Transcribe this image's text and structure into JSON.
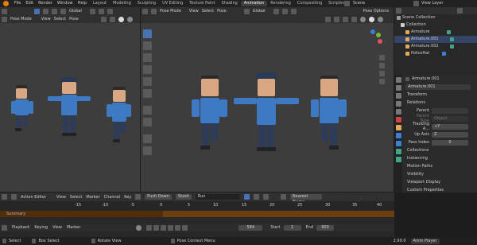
{
  "topbar": {
    "menus": [
      "File",
      "Edit",
      "Render",
      "Window",
      "Help"
    ],
    "workspaces": [
      "Layout",
      "Modeling",
      "Sculpting",
      "UV Editing",
      "Texture Paint",
      "Shading",
      "Animation",
      "Rendering",
      "Compositing",
      "Scripting"
    ],
    "active_workspace": "Animation",
    "scene_label": "Scene",
    "view_layer_label": "View Layer"
  },
  "left_viewport": {
    "header": {
      "orientation": "Global",
      "mode": "Pose Mode",
      "menus": [
        "View",
        "Select",
        "Pose"
      ]
    }
  },
  "right_viewport": {
    "header": {
      "mode": "Pose Mode",
      "menus": [
        "View",
        "Select",
        "Pose"
      ],
      "orientation": "Global",
      "options": "Pose Options"
    }
  },
  "outliner": {
    "rows": [
      {
        "label": "Scene Collection",
        "indent": 0
      },
      {
        "label": "Collection",
        "indent": 1
      },
      {
        "label": "Armature",
        "indent": 2
      },
      {
        "label": "Armature.001",
        "indent": 2
      },
      {
        "label": "Armature.002",
        "indent": 2
      },
      {
        "label": "PoliceHat",
        "indent": 2
      }
    ]
  },
  "properties": {
    "object_name": "Armature.001",
    "datablock_name": "Armature.001",
    "sections": [
      "Transform",
      "Relations"
    ],
    "relations": {
      "parent_label": "Parent",
      "parent_type_label": "Parent Type",
      "parent_type_value": "Object",
      "tracking_label": "Tracking A...",
      "tracking_value": "+Y",
      "up_axis_label": "Up Axis",
      "up_axis_value": "Z",
      "pass_index_label": "Pass Index",
      "pass_index_value": "0"
    },
    "more_sections": [
      "Collections",
      "Instancing",
      "Motion Paths",
      "Visibility",
      "Viewport Display",
      "Custom Properties"
    ]
  },
  "timeline": {
    "header": {
      "editor": "Action Editor",
      "menus": [
        "View",
        "Select",
        "Marker",
        "Channel",
        "Key"
      ],
      "push_down": "Push Down",
      "stash": "Stash",
      "action_name": "Run",
      "interp": "Nearest Frame"
    },
    "ruler": [
      "-15",
      "-10",
      "-5",
      "0",
      "5",
      "10",
      "15",
      "20",
      "25",
      "30",
      "35",
      "40"
    ],
    "summary_label": "Summary",
    "playback": {
      "menus": [
        "Playback",
        "Keying",
        "View",
        "Marker"
      ],
      "current_frame": "584",
      "start_label": "Start",
      "start_value": "1",
      "end_label": "End",
      "end_value": "900"
    }
  },
  "statusbar": {
    "items": [
      "Select",
      "Box Select",
      "Rotate View",
      "Pose Context Menu"
    ],
    "version": "2.90.0",
    "app": "Anim Player"
  }
}
